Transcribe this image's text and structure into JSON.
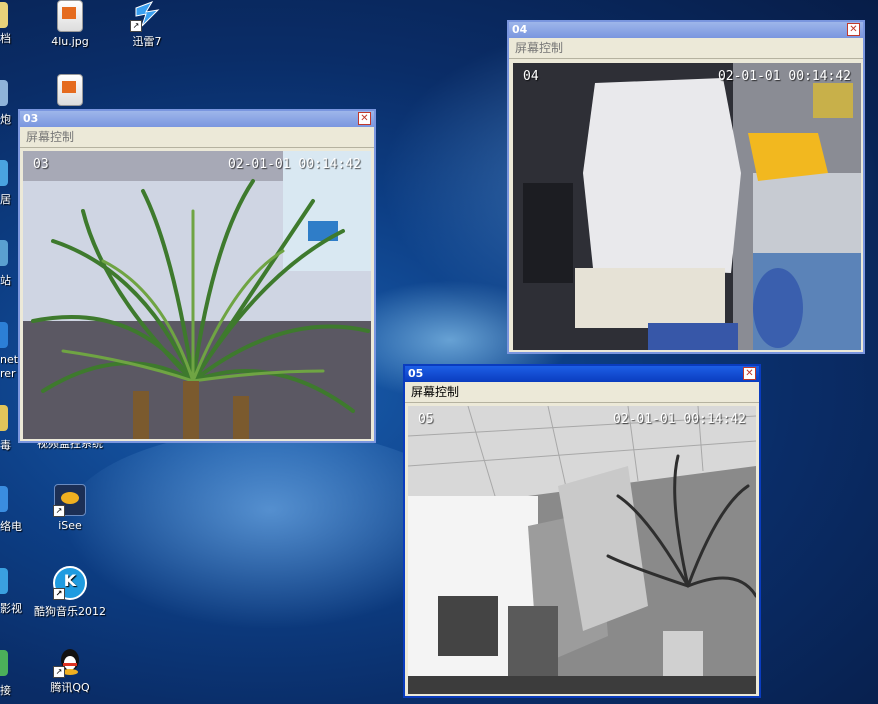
{
  "desktop": {
    "icons": [
      {
        "label": "4lu.jpg",
        "icon": "jpg-file-icon"
      },
      {
        "label": "迅雷7",
        "icon": "thunder-icon"
      },
      {
        "label": "",
        "icon": "image-file-icon"
      },
      {
        "label": "视频监控系统",
        "icon": "surveillance-app-icon"
      },
      {
        "label": "iSee",
        "icon": "isee-icon"
      },
      {
        "label": "酷狗音乐2012",
        "icon": "kugou-icon"
      },
      {
        "label": "腾讯QQ",
        "icon": "qq-icon"
      }
    ],
    "left_labels": [
      "档",
      "炮",
      "居",
      "站",
      "net",
      "rer",
      "毒",
      "络电",
      "影视",
      "接"
    ]
  },
  "windows": [
    {
      "id": "03",
      "menu": "屏幕控制",
      "channel": "03",
      "timestamp": "02-01-01  00:14:42"
    },
    {
      "id": "04",
      "menu": "屏幕控制",
      "channel": "04",
      "timestamp": "02-01-01  00:14:42"
    },
    {
      "id": "05",
      "menu": "屏幕控制",
      "channel": "05",
      "timestamp": "02-01-01  00:14:42"
    }
  ]
}
